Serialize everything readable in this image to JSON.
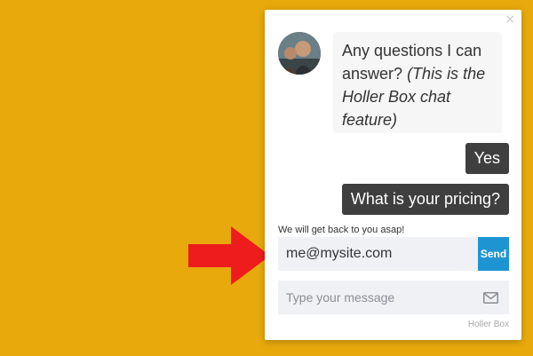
{
  "chat": {
    "close_symbol": "×",
    "greeting_plain": "Any questions I can answer?",
    "greeting_italic": "(This is the Holler Box chat feature)",
    "replies": [
      "Yes",
      "What is your pricing?"
    ],
    "notice": "We will get back to you asap!",
    "email_value": "me@mysite.com",
    "send_label": "Send",
    "message_placeholder": "Type your message",
    "brand": "Holler Box"
  },
  "icons": {
    "close": "close-icon",
    "mail": "envelope-icon",
    "pointer": "red-arrow-icon"
  },
  "colors": {
    "background": "#e8a90c",
    "send_button": "#1e95d2",
    "reply_bubble": "#3f3f3f",
    "arrow": "#ee1c1c"
  }
}
